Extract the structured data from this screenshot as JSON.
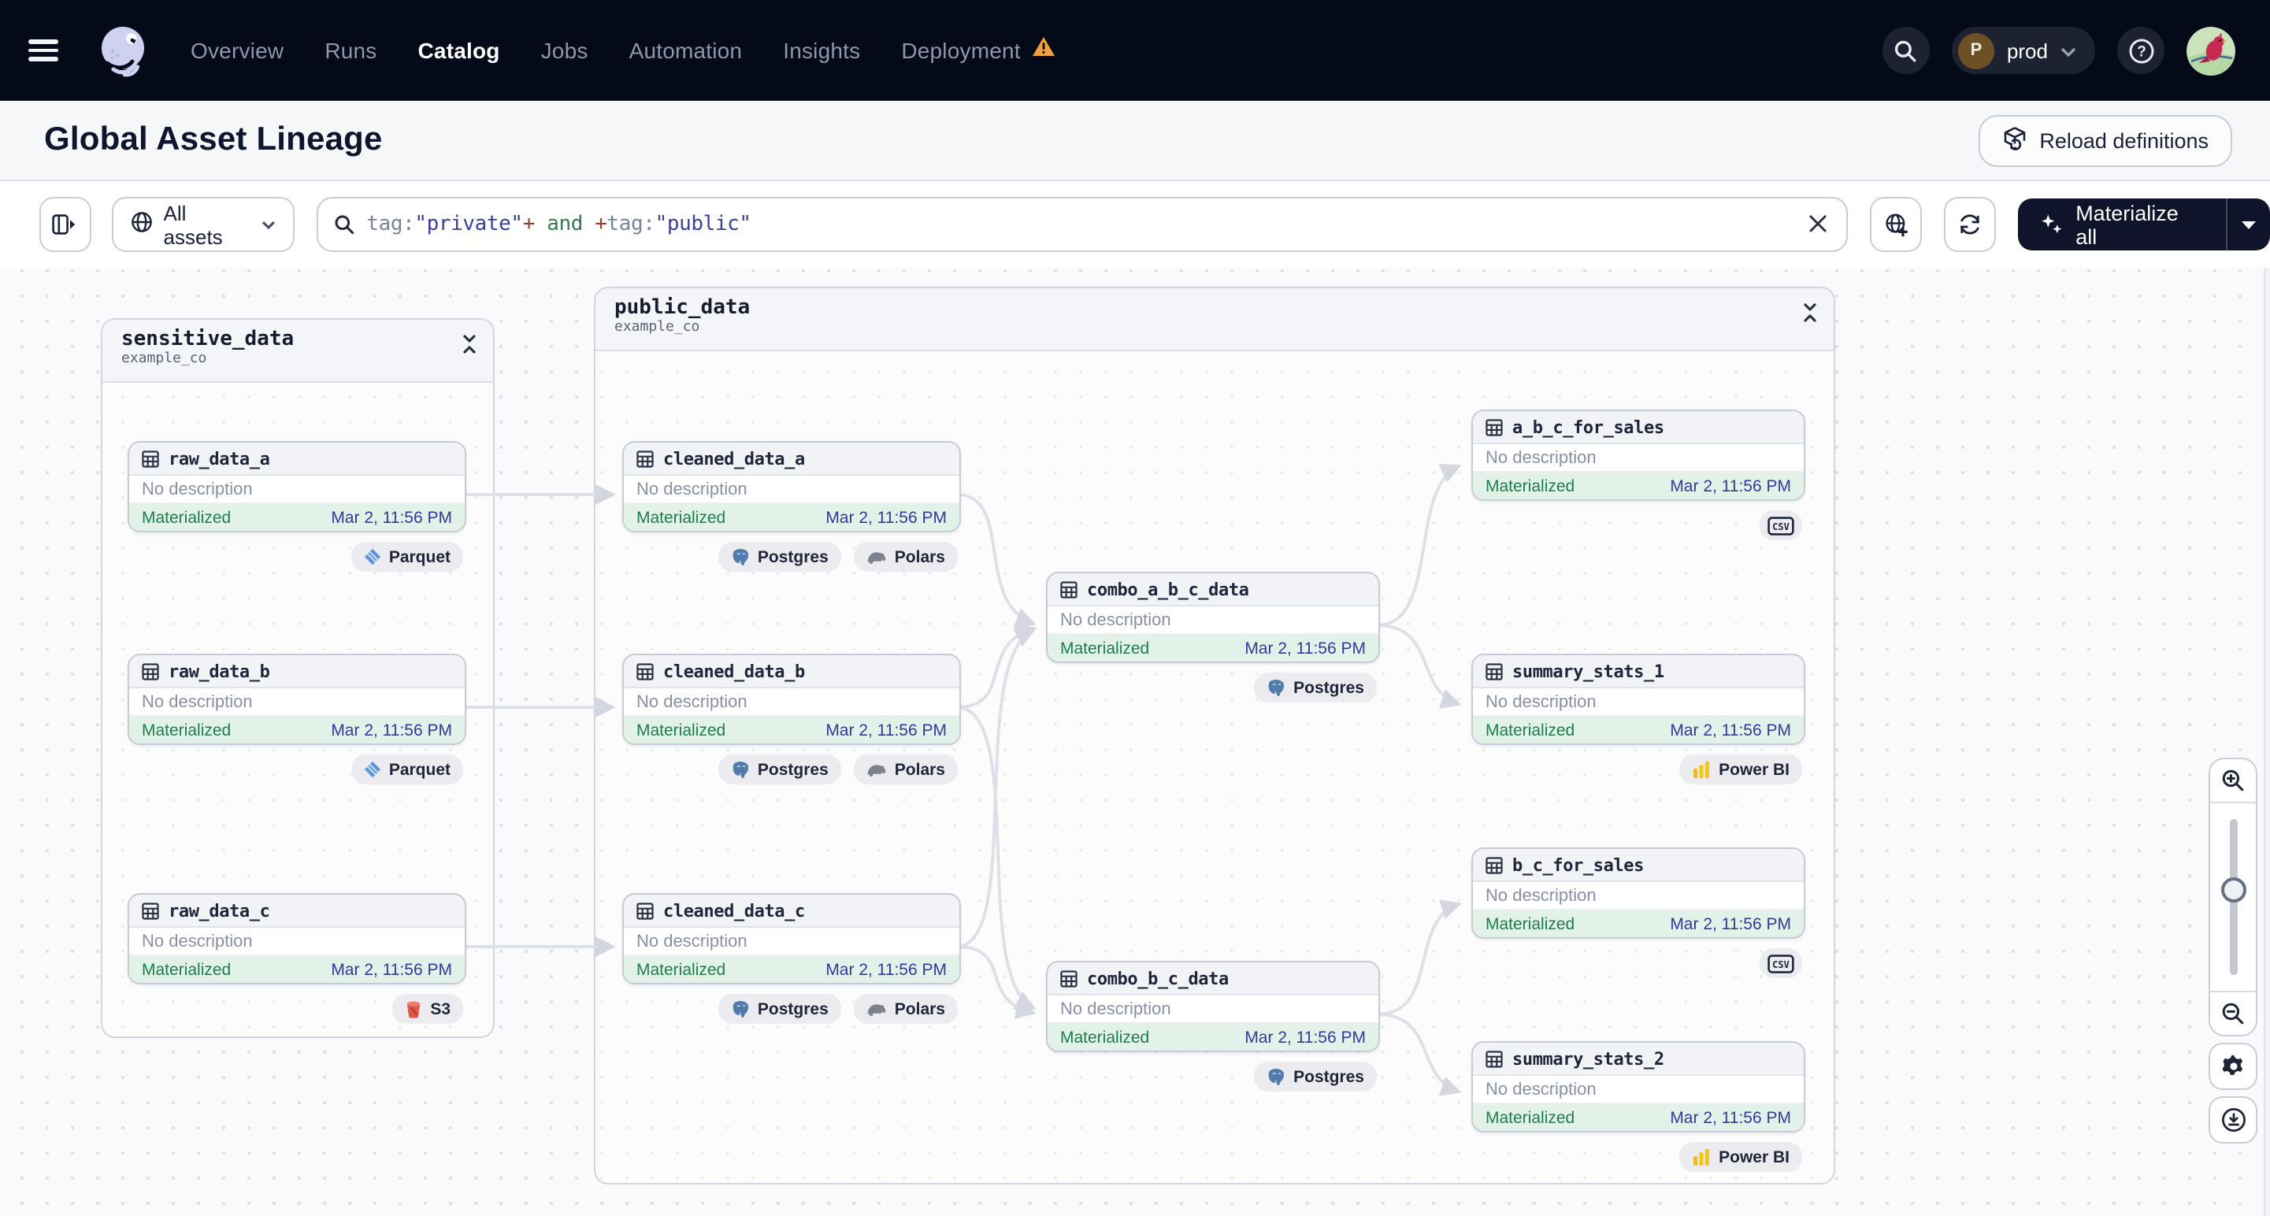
{
  "nav": {
    "items": [
      {
        "label": "Overview"
      },
      {
        "label": "Runs"
      },
      {
        "label": "Catalog"
      },
      {
        "label": "Jobs"
      },
      {
        "label": "Automation"
      },
      {
        "label": "Insights"
      },
      {
        "label": "Deployment"
      }
    ],
    "active_item": "Catalog",
    "deployment_has_warning": true,
    "environment": {
      "initial": "P",
      "name": "prod"
    },
    "icons": [
      "hamburger-icon",
      "dagster-logo",
      "warning-triangle-icon",
      "search-icon",
      "chevron-down-icon",
      "help-icon",
      "user-avatar"
    ]
  },
  "header": {
    "title": "Global Asset Lineage",
    "reload_label": "Reload definitions",
    "reload_icon": "cube-reload-icon"
  },
  "filter_bar": {
    "scope_label": "All assets",
    "scope_icon": "globe-icon",
    "query_tokens": [
      {
        "text": "tag:",
        "kind": "key"
      },
      {
        "text": "\"private\"",
        "kind": "value"
      },
      {
        "text": "+",
        "kind": "op"
      },
      {
        "text": " and ",
        "kind": "keyword"
      },
      {
        "text": "+",
        "kind": "op"
      },
      {
        "text": "tag:",
        "kind": "key"
      },
      {
        "text": "\"public\"",
        "kind": "value"
      }
    ],
    "clear_icon": "close-icon",
    "aux_icons": [
      "globe-add-icon",
      "refresh-icon"
    ],
    "materialize_label": "Materialize all",
    "materialize_icon": "sparkles-icon",
    "materialize_caret": "caret-down-icon"
  },
  "canvas": {
    "groups": [
      {
        "name": "sensitive_data",
        "subtitle": "example_co",
        "collapse_icon": "collapse-icon"
      },
      {
        "name": "public_data",
        "subtitle": "example_co",
        "collapse_icon": "collapse-icon"
      }
    ],
    "assets": [
      {
        "name": "raw_data_a",
        "description": "No description",
        "status": "Materialized",
        "timestamp": "Mar 2, 11:56 PM",
        "badges": [
          "Parquet"
        ]
      },
      {
        "name": "raw_data_b",
        "description": "No description",
        "status": "Materialized",
        "timestamp": "Mar 2, 11:56 PM",
        "badges": [
          "Parquet"
        ]
      },
      {
        "name": "raw_data_c",
        "description": "No description",
        "status": "Materialized",
        "timestamp": "Mar 2, 11:56 PM",
        "badges": [
          "S3"
        ]
      },
      {
        "name": "cleaned_data_a",
        "description": "No description",
        "status": "Materialized",
        "timestamp": "Mar 2, 11:56 PM",
        "badges": [
          "Postgres",
          "Polars"
        ]
      },
      {
        "name": "cleaned_data_b",
        "description": "No description",
        "status": "Materialized",
        "timestamp": "Mar 2, 11:56 PM",
        "badges": [
          "Postgres",
          "Polars"
        ]
      },
      {
        "name": "cleaned_data_c",
        "description": "No description",
        "status": "Materialized",
        "timestamp": "Mar 2, 11:56 PM",
        "badges": [
          "Postgres",
          "Polars"
        ]
      },
      {
        "name": "combo_a_b_c_data",
        "description": "No description",
        "status": "Materialized",
        "timestamp": "Mar 2, 11:56 PM",
        "badges": [
          "Postgres"
        ]
      },
      {
        "name": "combo_b_c_data",
        "description": "No description",
        "status": "Materialized",
        "timestamp": "Mar 2, 11:56 PM",
        "badges": [
          "Postgres"
        ]
      },
      {
        "name": "a_b_c_for_sales",
        "description": "No description",
        "status": "Materialized",
        "timestamp": "Mar 2, 11:56 PM",
        "badges": [
          "csv"
        ]
      },
      {
        "name": "summary_stats_1",
        "description": "No description",
        "status": "Materialized",
        "timestamp": "Mar 2, 11:56 PM",
        "badges": [
          "Power BI"
        ]
      },
      {
        "name": "b_c_for_sales",
        "description": "No description",
        "status": "Materialized",
        "timestamp": "Mar 2, 11:56 PM",
        "badges": [
          "csv"
        ]
      },
      {
        "name": "summary_stats_2",
        "description": "No description",
        "status": "Materialized",
        "timestamp": "Mar 2, 11:56 PM",
        "badges": [
          "Power BI"
        ]
      }
    ],
    "csv_label": "CSV"
  },
  "toolbar": {
    "icons": [
      "zoom-in-icon",
      "zoom-slider",
      "zoom-out-icon",
      "settings-icon",
      "download-icon"
    ]
  },
  "colors": {
    "nav_bg": "#050a18",
    "accent_dark_button": "#10142a",
    "status_green": "#1d7d4d",
    "status_green_bg": "#e2f2e8",
    "timestamp_indigo": "#33389b",
    "warning_amber": "#f0a13c",
    "edge_gray": "#dde0e7"
  }
}
